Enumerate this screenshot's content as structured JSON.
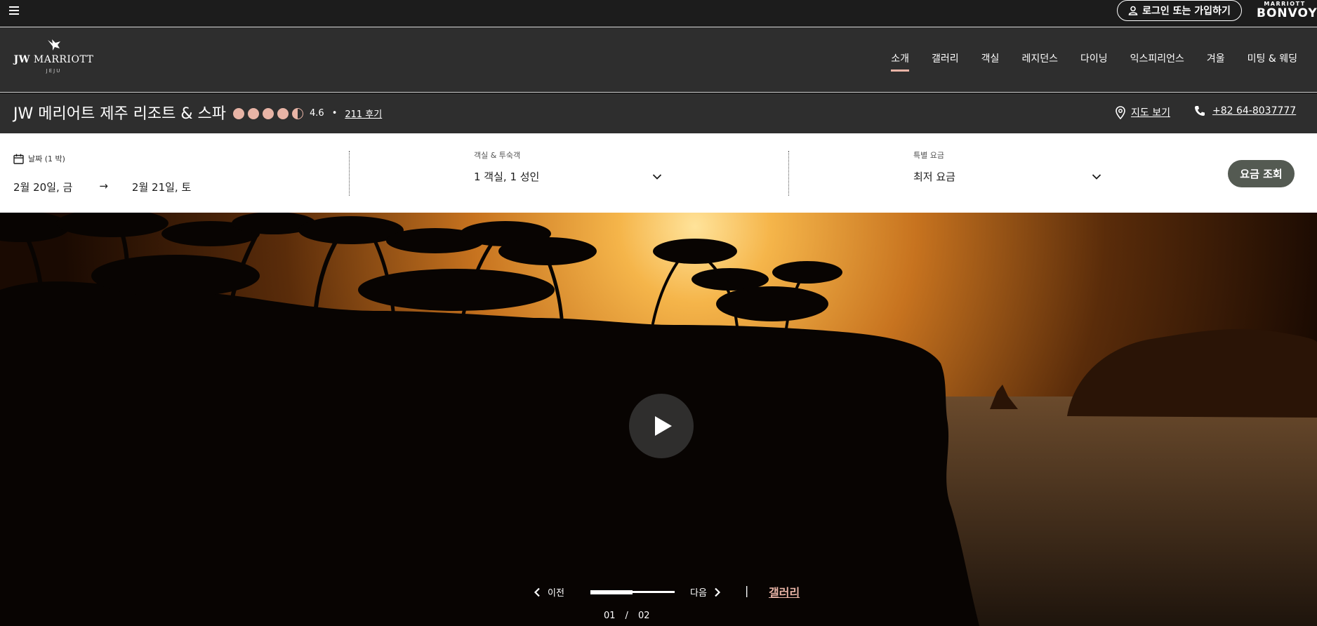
{
  "topbar": {
    "menu_icon": "hamburger-icon",
    "login_label": "로그인 또는 가입하기",
    "brand_small": "MARRIOTT",
    "brand_big": "BONVOY"
  },
  "logo": {
    "jw": "JW",
    "marriott": "MARRIOTT",
    "city": "JEJU"
  },
  "nav": {
    "items": [
      "소개",
      "갤러리",
      "객실",
      "레지던스",
      "다이닝",
      "익스피리언스",
      "겨울",
      "미팅 & 웨딩"
    ],
    "active": "소개"
  },
  "hotel": {
    "name": "JW 메리어트 제주 리조트 & 스파",
    "rating": 4.6,
    "rating_text": "4.6",
    "bullet": "•",
    "reviews": "211 후기",
    "map_label": "지도 보기",
    "phone": "+82 64-8037777"
  },
  "booking": {
    "dates_label": "날짜 (1 박)",
    "checkin": "2월 20일, 금",
    "arrow": "→",
    "checkout": "2월 21일, 토",
    "rooms_label": "객실 & 투숙객",
    "rooms_value": "1 객실, 1 성인",
    "rate_label": "특별 요금",
    "rate_value": "최저 요금",
    "search_label": "요금 조회"
  },
  "hero": {
    "prev_label": "이전",
    "next_label": "다음",
    "progress": 0.5,
    "separator": "|",
    "gallery_label": "갤러리",
    "current": "01",
    "slash": "/",
    "total": "02"
  },
  "colors": {
    "accent": "#e8b4a6",
    "dark": "#2e2e2e",
    "topbar": "#1c1c1c",
    "button": "#545a52"
  }
}
